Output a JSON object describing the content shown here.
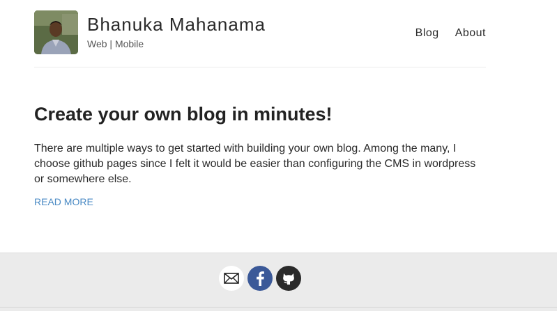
{
  "header": {
    "site_title": "Bhanuka Mahanama",
    "site_description": "Web | Mobile",
    "nav": [
      {
        "label": "Blog"
      },
      {
        "label": "About"
      }
    ]
  },
  "post": {
    "title": "Create your own blog in minutes!",
    "excerpt": "There are multiple ways to get started with building your own blog. Among the many, I choose github pages since I felt it would be easier than configuring the CMS in wordpress or somewhere else.",
    "read_more": "READ MORE"
  },
  "footer": {
    "social": [
      {
        "icon": "email-icon",
        "color": "#ffffff"
      },
      {
        "icon": "facebook-icon",
        "color": "#3b5998"
      },
      {
        "icon": "github-icon",
        "color": "#2a2a2a"
      }
    ]
  },
  "colors": {
    "link": "#4a8ac4",
    "footer_bg": "#ebebeb"
  }
}
